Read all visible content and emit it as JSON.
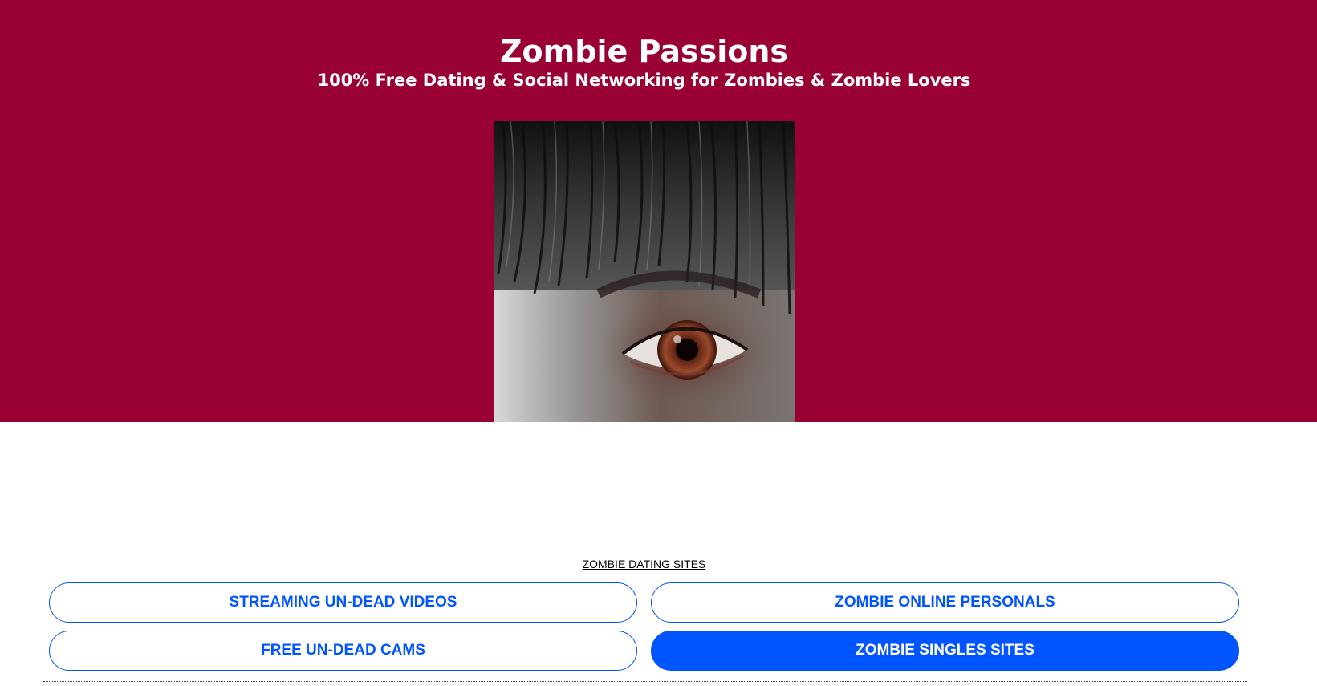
{
  "header": {
    "title": "Zombie Passions",
    "tagline": "100% Free Dating & Social Networking for Zombies & Zombie Lovers",
    "background_color": "#990033",
    "hero_image": "zombie-eye-image"
  },
  "links_section": {
    "heading": "ZOMBIE DATING SITES",
    "buttons": [
      {
        "label": "STREAMING UN-DEAD VIDEOS",
        "style": "outline"
      },
      {
        "label": "ZOMBIE ONLINE PERSONALS",
        "style": "outline"
      },
      {
        "label": "FREE UN-DEAD CAMS",
        "style": "outline"
      },
      {
        "label": "ZOMBIE SINGLES SITES",
        "style": "filled"
      }
    ],
    "accent_color": "#0055ff"
  }
}
